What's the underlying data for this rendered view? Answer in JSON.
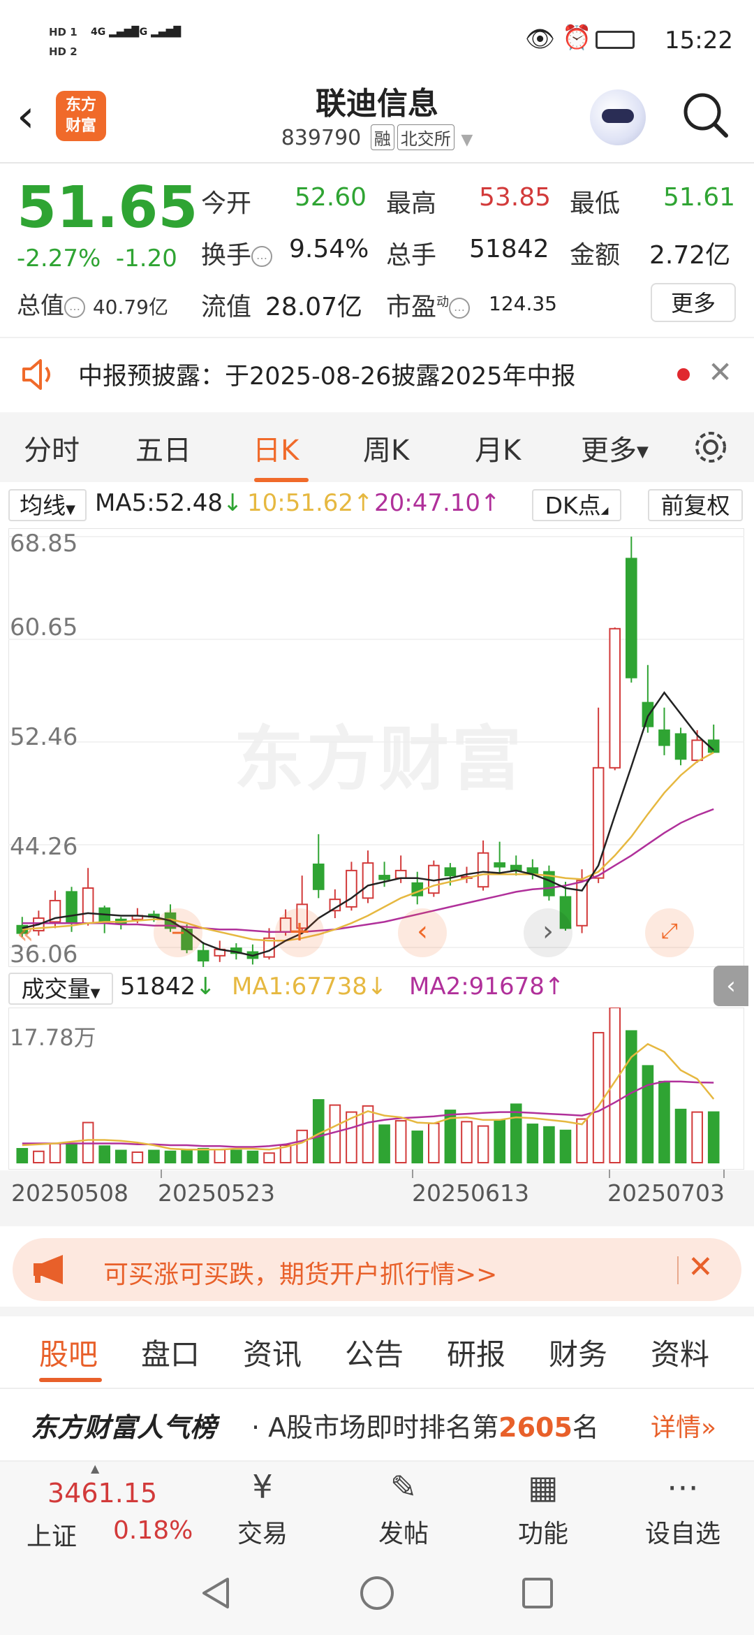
{
  "status_bar": {
    "time": "15:22",
    "left_badges": [
      "HD 1",
      "HD 2"
    ],
    "network": [
      "4G",
      "5G"
    ]
  },
  "header": {
    "title": "联迪信息",
    "code": "839790",
    "tag_margin": "融",
    "tag_exchange": "北交所",
    "logo_text": "东方财富"
  },
  "quote": {
    "price": "51.65",
    "change_pct": "-2.27%",
    "change_amt": "-1.20",
    "market_value_label": "总值",
    "market_value": "40.79亿",
    "open_label": "今开",
    "open": "52.60",
    "high_label": "最高",
    "high": "53.85",
    "low_label": "最低",
    "low": "51.61",
    "turnover_label": "换手",
    "turnover": "9.54%",
    "volume_label": "总手",
    "volume": "51842",
    "amount_label": "金额",
    "amount": "2.72亿",
    "float_label": "流值",
    "float_value": "28.07亿",
    "pe_label": "市盈",
    "pe_sup": "动",
    "pe": "124.35",
    "more_button": "更多"
  },
  "notice": {
    "text": "中报预披露：于2025-08-26披露2025年中报"
  },
  "chart_tabs": [
    "分时",
    "五日",
    "日K",
    "周K",
    "月K",
    "更多"
  ],
  "active_chart_tab": "日K",
  "ma_bar": {
    "ma_button": "均线",
    "ma5": "MA5:52.48",
    "ma10": "10:51.62",
    "ma20": "20:47.10",
    "dk_button": "DK点",
    "adjust_button": "前复权"
  },
  "price_axis": [
    "68.85",
    "60.65",
    "52.46",
    "44.26",
    "36.06"
  ],
  "watermark": "东方财富",
  "volume_bar": {
    "label": "成交量",
    "value": "51842",
    "ma1": "MA1:67738",
    "ma2": "MA2:91678",
    "axis_top": "17.78万"
  },
  "dates": [
    "20250508",
    "20250523",
    "20250613",
    "20250703"
  ],
  "chart_data": {
    "type": "candlestick",
    "ylim": [
      36.06,
      68.85
    ],
    "candles": [
      {
        "o": 37.8,
        "c": 37.2,
        "h": 38.5,
        "l": 36.9
      },
      {
        "o": 37.4,
        "c": 38.4,
        "h": 39.0,
        "l": 37.0
      },
      {
        "o": 38.1,
        "c": 39.8,
        "h": 40.6,
        "l": 37.6
      },
      {
        "o": 40.5,
        "c": 38.0,
        "h": 40.9,
        "l": 37.3
      },
      {
        "o": 38.0,
        "c": 40.8,
        "h": 42.4,
        "l": 37.8
      },
      {
        "o": 39.2,
        "c": 38.1,
        "h": 39.4,
        "l": 37.2
      },
      {
        "o": 38.3,
        "c": 38.0,
        "h": 38.5,
        "l": 37.5
      },
      {
        "o": 38.3,
        "c": 38.6,
        "h": 39.2,
        "l": 38.0
      },
      {
        "o": 38.7,
        "c": 38.5,
        "h": 39.0,
        "l": 38.1
      },
      {
        "o": 38.8,
        "c": 37.6,
        "h": 39.5,
        "l": 37.3
      },
      {
        "o": 37.5,
        "c": 35.9,
        "h": 37.9,
        "l": 35.6
      },
      {
        "o": 35.8,
        "c": 35.0,
        "h": 36.5,
        "l": 34.4
      },
      {
        "o": 35.4,
        "c": 35.9,
        "h": 36.6,
        "l": 34.9
      },
      {
        "o": 36.0,
        "c": 35.6,
        "h": 36.4,
        "l": 35.1
      },
      {
        "o": 35.7,
        "c": 35.2,
        "h": 36.3,
        "l": 34.7
      },
      {
        "o": 35.3,
        "c": 36.8,
        "h": 37.6,
        "l": 35.1
      },
      {
        "o": 37.3,
        "c": 38.4,
        "h": 39.1,
        "l": 37.0
      },
      {
        "o": 37.6,
        "c": 39.5,
        "h": 41.8,
        "l": 37.2
      },
      {
        "o": 42.7,
        "c": 40.7,
        "h": 45.1,
        "l": 40.0
      },
      {
        "o": 39.0,
        "c": 39.9,
        "h": 40.7,
        "l": 38.4
      },
      {
        "o": 39.3,
        "c": 42.2,
        "h": 42.9,
        "l": 39.0
      },
      {
        "o": 40.0,
        "c": 42.8,
        "h": 43.8,
        "l": 39.6
      },
      {
        "o": 41.8,
        "c": 41.5,
        "h": 42.9,
        "l": 40.9
      },
      {
        "o": 41.6,
        "c": 42.2,
        "h": 43.4,
        "l": 41.2
      },
      {
        "o": 41.2,
        "c": 40.2,
        "h": 42.1,
        "l": 39.5
      },
      {
        "o": 40.4,
        "c": 42.6,
        "h": 43.0,
        "l": 40.1
      },
      {
        "o": 42.4,
        "c": 41.8,
        "h": 42.8,
        "l": 41.0
      },
      {
        "o": 41.6,
        "c": 41.7,
        "h": 42.5,
        "l": 41.2
      },
      {
        "o": 40.9,
        "c": 43.6,
        "h": 44.6,
        "l": 40.6
      },
      {
        "o": 42.8,
        "c": 42.5,
        "h": 44.5,
        "l": 42.0
      },
      {
        "o": 42.6,
        "c": 42.2,
        "h": 43.4,
        "l": 41.8
      },
      {
        "o": 42.4,
        "c": 42.0,
        "h": 43.1,
        "l": 41.5
      },
      {
        "o": 42.1,
        "c": 40.2,
        "h": 42.6,
        "l": 39.8
      },
      {
        "o": 40.1,
        "c": 37.6,
        "h": 41.3,
        "l": 37.4
      },
      {
        "o": 37.8,
        "c": 41.4,
        "h": 42.3,
        "l": 37.2
      },
      {
        "o": 41.6,
        "c": 50.4,
        "h": 55.2,
        "l": 41.2
      },
      {
        "o": 50.4,
        "c": 61.5,
        "h": 61.6,
        "l": 50.2
      },
      {
        "o": 67.1,
        "c": 57.6,
        "h": 68.85,
        "l": 57.2
      },
      {
        "o": 55.6,
        "c": 53.7,
        "h": 58.6,
        "l": 53.2
      },
      {
        "o": 53.4,
        "c": 52.2,
        "h": 55.2,
        "l": 51.4
      },
      {
        "o": 53.1,
        "c": 51.1,
        "h": 53.6,
        "l": 50.6
      },
      {
        "o": 51.0,
        "c": 52.6,
        "h": 53.4,
        "l": 50.8
      },
      {
        "o": 52.6,
        "c": 51.65,
        "h": 53.85,
        "l": 51.61
      }
    ],
    "ma5": [
      37.6,
      37.9,
      38.4,
      38.6,
      38.8,
      38.7,
      38.6,
      38.6,
      38.5,
      38.2,
      37.4,
      36.4,
      35.9,
      35.7,
      35.4,
      35.8,
      36.6,
      37.2,
      38.4,
      39.2,
      40.0,
      41.0,
      41.3,
      41.6,
      41.6,
      41.4,
      41.6,
      41.9,
      42.1,
      42.0,
      42.2,
      41.9,
      41.4,
      40.8,
      40.6,
      42.6,
      46.6,
      50.5,
      54.5,
      56.4,
      54.7,
      53.0,
      51.8
    ],
    "ma10": [
      37.5,
      37.6,
      37.7,
      37.8,
      38.0,
      38.1,
      38.1,
      38.2,
      38.3,
      38.3,
      38.0,
      37.6,
      37.3,
      37.0,
      36.7,
      36.6,
      36.6,
      36.8,
      37.1,
      37.5,
      38.0,
      38.6,
      39.3,
      40.0,
      40.5,
      41.0,
      41.3,
      41.6,
      41.9,
      41.9,
      41.9,
      41.9,
      41.8,
      41.6,
      41.5,
      42.1,
      43.4,
      44.9,
      46.7,
      48.4,
      49.8,
      50.9,
      51.62
    ],
    "ma20": [
      38.0,
      38.0,
      38.0,
      38.0,
      38.0,
      38.0,
      37.9,
      37.9,
      37.8,
      37.8,
      37.7,
      37.6,
      37.5,
      37.5,
      37.4,
      37.3,
      37.3,
      37.3,
      37.4,
      37.5,
      37.7,
      37.9,
      38.1,
      38.4,
      38.7,
      39.0,
      39.3,
      39.6,
      39.9,
      40.2,
      40.5,
      40.7,
      40.8,
      41.0,
      41.3,
      41.8,
      42.6,
      43.4,
      44.3,
      45.2,
      46.0,
      46.6,
      47.1
    ],
    "volume": [
      1.6,
      1.3,
      2.2,
      2.1,
      4.6,
      1.9,
      1.4,
      1.2,
      1.4,
      1.3,
      1.5,
      1.6,
      1.5,
      1.4,
      1.3,
      1.1,
      2.0,
      3.7,
      7.2,
      6.6,
      5.8,
      6.5,
      4.3,
      4.8,
      3.6,
      4.5,
      6.0,
      4.7,
      4.2,
      4.9,
      6.7,
      4.4,
      4.1,
      3.7,
      5.0,
      14.9,
      17.78,
      15.1,
      11.1,
      9.3,
      6.1,
      5.8,
      5.8
    ],
    "vol_ma1": [
      2.0,
      2.1,
      2.2,
      2.4,
      2.6,
      2.6,
      2.5,
      2.3,
      2.0,
      1.6,
      1.5,
      1.5,
      1.5,
      1.6,
      1.6,
      1.5,
      1.8,
      2.3,
      3.3,
      4.2,
      5.1,
      5.9,
      5.4,
      5.2,
      4.6,
      4.5,
      5.1,
      5.2,
      4.9,
      4.9,
      5.2,
      5.1,
      4.9,
      4.7,
      4.4,
      6.5,
      9.3,
      12.1,
      13.6,
      12.7,
      10.6,
      9.6,
      7.3
    ],
    "vol_ma2": [
      2.2,
      2.2,
      2.2,
      2.2,
      2.2,
      2.2,
      2.2,
      2.1,
      2.1,
      2.0,
      2.0,
      1.9,
      1.9,
      1.8,
      1.8,
      1.9,
      2.1,
      2.5,
      3.0,
      3.5,
      4.0,
      4.6,
      4.9,
      5.1,
      5.2,
      5.3,
      5.5,
      5.6,
      5.7,
      5.8,
      5.8,
      5.7,
      5.6,
      5.5,
      5.4,
      5.9,
      6.9,
      8.0,
      8.9,
      9.3,
      9.3,
      9.2,
      9.17
    ],
    "vol_ylim": [
      0,
      17.78
    ]
  },
  "ad": {
    "text": "可买涨可买跌，期货开户抓行情>>"
  },
  "bottom_tabs": [
    "股吧",
    "盘口",
    "资讯",
    "公告",
    "研报",
    "财务",
    "资料"
  ],
  "rank": {
    "brand": "东方财富人气榜",
    "text_prefix": "· A股市场即时排名第",
    "rank": "2605",
    "text_suffix": "名",
    "detail": "详情»"
  },
  "index": {
    "value": "3461.15",
    "name": "上证",
    "pct": "0.18%"
  },
  "nav": [
    {
      "label": "交易",
      "icon": "yen-cycle-icon"
    },
    {
      "label": "发帖",
      "icon": "edit-icon"
    },
    {
      "label": "功能",
      "icon": "grid-icon"
    },
    {
      "label": "设自选",
      "icon": "more-dots-icon"
    }
  ],
  "colors": {
    "up": "#d23a3a",
    "down": "#2fa433",
    "accent": "#f06a2a",
    "ma5": "#222222",
    "ma10": "#e6b840",
    "ma20": "#b0309a"
  }
}
